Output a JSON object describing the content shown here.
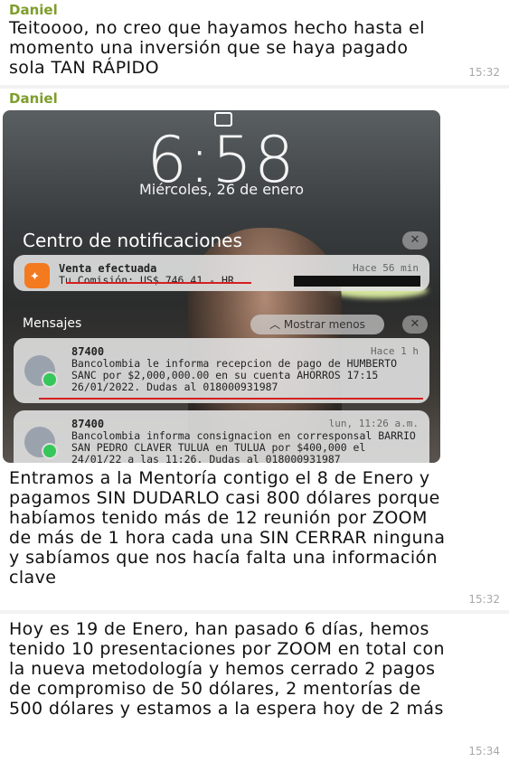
{
  "messages": [
    {
      "sender": "Daniel",
      "text": "Teitoooo, no creo que hayamos hecho hasta el momento una inversión que se haya pagado sola TAN RÁPIDO",
      "time": "15:32"
    },
    {
      "sender": "Daniel",
      "text": "Entramos a la Mentoría contigo el 8 de Enero y pagamos SIN DUDARLO casi 800 dólares porque habíamos tenido más de 12 reunión por ZOOM de más de 1 hora cada una SIN CERRAR ninguna y sabíamos que nos hacía falta una información clave",
      "time": "15:32"
    },
    {
      "text": "Hoy es 19 de Enero, han pasado 6 días, hemos tenido 10 presentaciones por ZOOM en total con la nueva metodología y hemos cerrado 2 pagos de compromiso de 50 dólares, 2 mentorías de 500 dólares y estamos a la espera hoy de 2 más",
      "time": "15:34"
    }
  ],
  "screenshot": {
    "clock": "6:58",
    "date": "Miércoles, 26 de enero",
    "notification_center_title": "Centro de notificaciones",
    "close_label": "✕",
    "sale_card": {
      "title": "Venta efectuada",
      "ago": "Hace 56 min",
      "body": "Tu Comisión: US$ 746.41 - HR"
    },
    "messages_section_title": "Mensajes",
    "show_less": "Mostrar menos",
    "sms_cards": [
      {
        "sender": "87400",
        "ago": "Hace 1 h",
        "body": "Bancolombia le informa recepcion de pago de HUMBERTO   SANC por $2,000,000.00 en su cuenta AHORROS 17:15 26/01/2022. Dudas al 018000931987"
      },
      {
        "sender": "87400",
        "ago": "lun, 11:26 a.m.",
        "body": "Bancolombia informa consignacion en corresponsal BARRIO SAN PEDRO CLAVER TULUA en TULUA por $400,000 el 24/01/22 a las 11:26. Dudas al 018000931987"
      }
    ]
  },
  "colors": {
    "sender": "#7e9d2b",
    "time": "#a8a8a8",
    "highlight": "#d42020",
    "app_icon": "#f47a1f"
  }
}
